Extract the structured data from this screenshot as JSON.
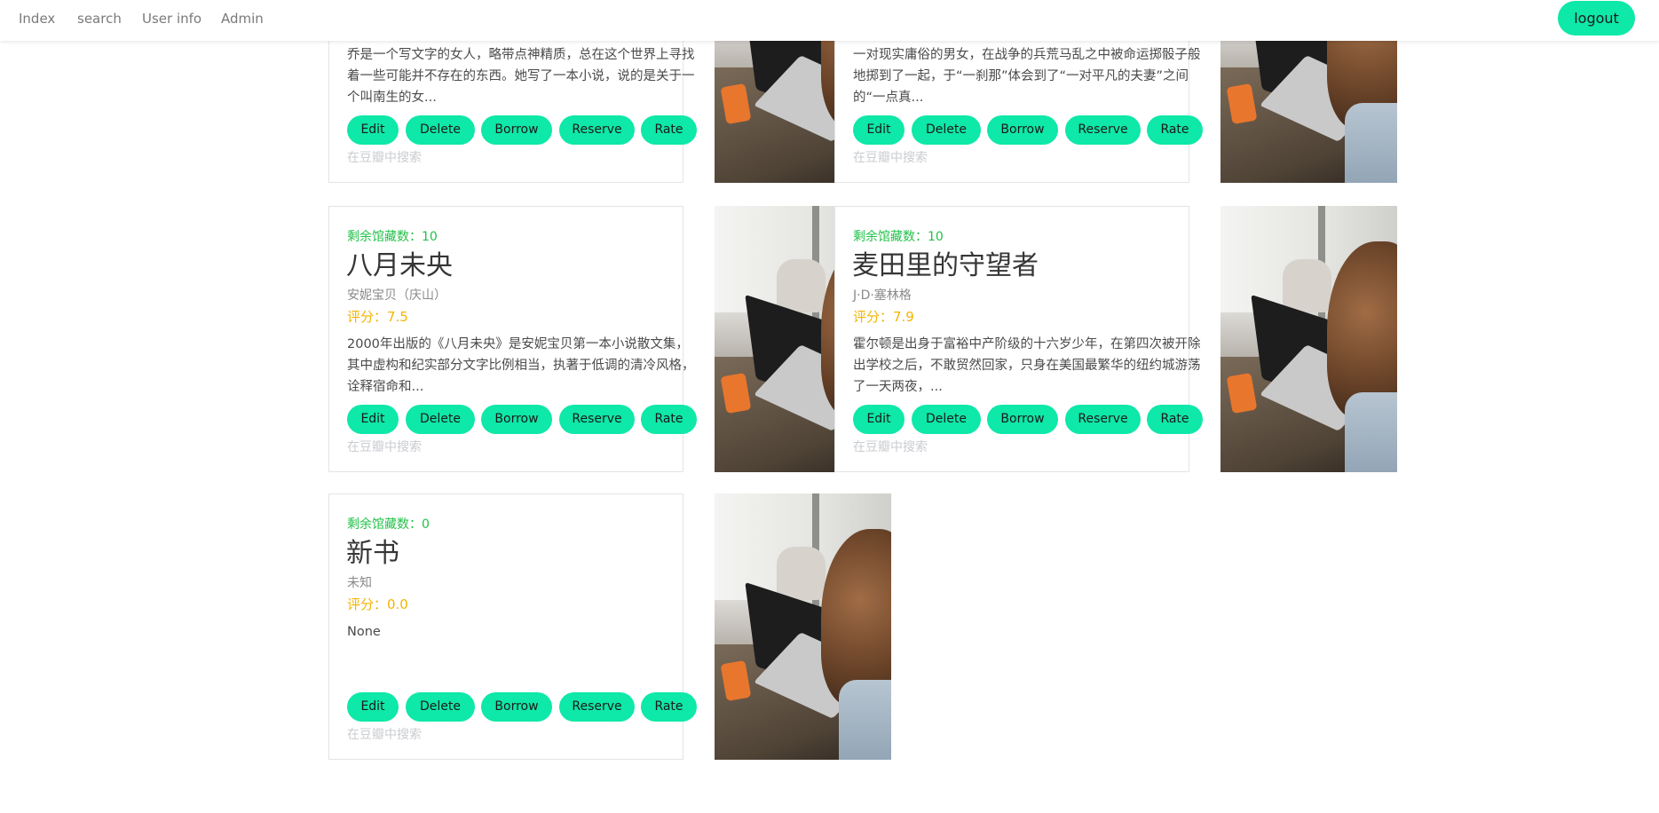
{
  "nav": {
    "links": [
      "Index",
      "search",
      "User info",
      "Admin"
    ],
    "logout_label": "logout"
  },
  "buttons": {
    "edit": "Edit",
    "delete": "Delete",
    "borrow": "Borrow",
    "reserve": "Reserve",
    "rate": "Rate",
    "douban": "在豆瓣中搜索"
  },
  "books": [
    {
      "stock": "",
      "title": "",
      "author": "",
      "rating": "",
      "desc": "乔是一个写文字的女人，略带点神精质，总在这个世界上寻找着一些可能并不存在的东西。她写了一本小说，说的是关于一个叫南生的女..."
    },
    {
      "stock": "",
      "title": "",
      "author": "",
      "rating": "",
      "desc": "一对现实庸俗的男女，在战争的兵荒马乱之中被命运掷骰子般地掷到了一起，于“一刹那”体会到了“一对平凡的夫妻”之间的“一点真..."
    },
    {
      "stock": "剩余馆藏数：10",
      "title": "八月未央",
      "author": "安妮宝贝（庆山）",
      "rating": "评分：7.5",
      "desc": "2000年出版的《八月未央》是安妮宝贝第一本小说散文集，其中虚构和纪实部分文字比例相当，执著于低调的清冷风格，诠释宿命和..."
    },
    {
      "stock": "剩余馆藏数：10",
      "title": "麦田里的守望者",
      "author": "J·D·塞林格",
      "rating": "评分：7.9",
      "desc": "霍尔顿是出身于富裕中产阶级的十六岁少年，在第四次被开除出学校之后，不敢贸然回家，只身在美国最繁华的纽约城游荡了一天两夜，..."
    },
    {
      "stock": "剩余馆藏数：0",
      "title": "新书",
      "author": "未知",
      "rating": "评分：0.0",
      "desc": "None"
    }
  ]
}
